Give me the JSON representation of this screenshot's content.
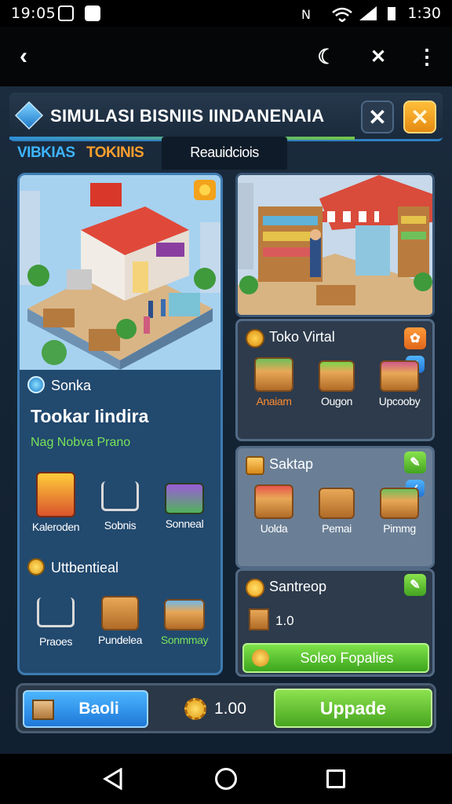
{
  "status_bar": {
    "time": "19:05",
    "clock": "1:30"
  },
  "top_bar": {
    "back_icon": "back-arrow-icon",
    "moon_icon": "moon-icon",
    "close_icon": "close-icon",
    "menu_icon": "more-vertical-icon"
  },
  "header": {
    "title": "SIMULASI BISNIIS IINDANENAIA",
    "close_dark": "✕",
    "close_orange": "✕"
  },
  "tabs": [
    {
      "label": "VIBKIAS"
    },
    {
      "label": "TOKINIS"
    },
    {
      "label": "Reauidciois"
    }
  ],
  "left_panel": {
    "section_label": "Sonka",
    "title": "Tookar Iindira",
    "subtitle": "Nag Nobva Prano",
    "items_row1": [
      {
        "label": "Kaleroden"
      },
      {
        "label": "Sobnis"
      },
      {
        "label": "Sonneal"
      }
    ],
    "section2_label": "Uttbentieal",
    "items_row2": [
      {
        "label": "Praoes"
      },
      {
        "label": "Pundelea"
      },
      {
        "label": "Sonmmay"
      }
    ]
  },
  "right_cards": {
    "card1": {
      "title": "Toko Virtal",
      "items": [
        {
          "label": "Anaiam"
        },
        {
          "label": "Ougon"
        },
        {
          "label": "Upcooby"
        }
      ]
    },
    "card2": {
      "title": "Saktap",
      "items": [
        {
          "label": "Uolda"
        },
        {
          "label": "Pemai"
        },
        {
          "label": "Pimmg"
        }
      ]
    },
    "card3": {
      "title": "Santreop",
      "value": "1.0",
      "button_label": "Soleo Fopalies"
    }
  },
  "bottom_bar": {
    "left_button": "Baoli",
    "value": "1.00",
    "upgrade_button": "Uppade"
  },
  "colors": {
    "accent_blue": "#2e8fd8",
    "accent_green": "#6bd23e",
    "accent_orange": "#ff9f2e",
    "panel_bg": "#22496e"
  }
}
